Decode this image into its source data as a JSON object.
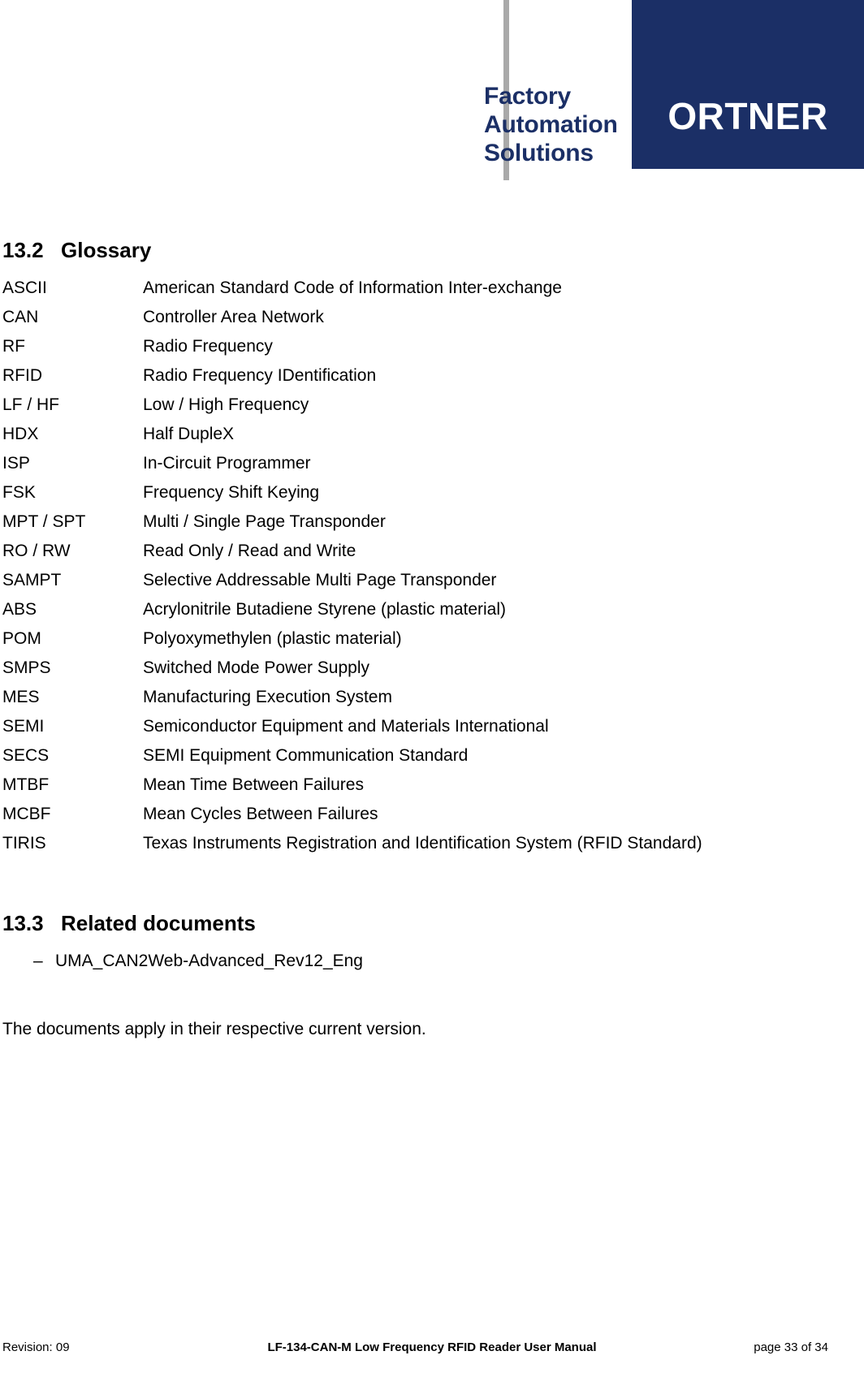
{
  "header": {
    "logo_lines": [
      "Factory",
      "Automation",
      "Solutions"
    ],
    "brand_name": "ORTNER",
    "brand_box_color": "#1b2f66",
    "logo_text_color": "#1b2f66",
    "rule_color": "#a9a9a9"
  },
  "sections": {
    "glossary": {
      "number": "13.2",
      "title": "Glossary",
      "entries": [
        {
          "term": "ASCII",
          "definition": "American Standard Code of Information Inter-exchange"
        },
        {
          "term": "CAN",
          "definition": "Controller Area Network"
        },
        {
          "term": "RF",
          "definition": "Radio Frequency"
        },
        {
          "term": "RFID",
          "definition": "Radio Frequency IDentification"
        },
        {
          "term": "LF / HF",
          "definition": "Low / High Frequency"
        },
        {
          "term": "HDX",
          "definition": "Half DupleX"
        },
        {
          "term": "ISP",
          "definition": "In-Circuit Programmer"
        },
        {
          "term": "FSK",
          "definition": "Frequency Shift Keying"
        },
        {
          "term": "MPT / SPT",
          "definition": "Multi / Single Page Transponder"
        },
        {
          "term": "RO / RW",
          "definition": "Read Only / Read and Write"
        },
        {
          "term": "SAMPT",
          "definition": "Selective Addressable Multi Page Transponder"
        },
        {
          "term": "ABS",
          "definition": "Acrylonitrile Butadiene Styrene (plastic material)"
        },
        {
          "term": "POM",
          "definition": "Polyoxymethylen (plastic material)"
        },
        {
          "term": "SMPS",
          "definition": "Switched Mode Power Supply"
        },
        {
          "term": "MES",
          "definition": "Manufacturing Execution System"
        },
        {
          "term": "SEMI",
          "definition": "Semiconductor Equipment and Materials International"
        },
        {
          "term": "SECS",
          "definition": "SEMI  Equipment Communication Standard"
        },
        {
          "term": "MTBF",
          "definition": "Mean Time Between Failures"
        },
        {
          "term": "MCBF",
          "definition": "Mean Cycles Between Failures"
        },
        {
          "term": "TIRIS",
          "definition": "Texas Instruments Registration and Identification System (RFID Standard)"
        }
      ]
    },
    "related_documents": {
      "number": "13.3",
      "title": "Related documents",
      "bullet_glyph": "–",
      "items": [
        "UMA_CAN2Web-Advanced_Rev12_Eng"
      ],
      "closing_note": "The documents apply in their respective current version."
    }
  },
  "footer": {
    "revision": "Revision: 09",
    "document_title": "LF-134-CAN-M Low Frequency RFID Reader User Manual",
    "page_number": "page 33 of 34"
  }
}
